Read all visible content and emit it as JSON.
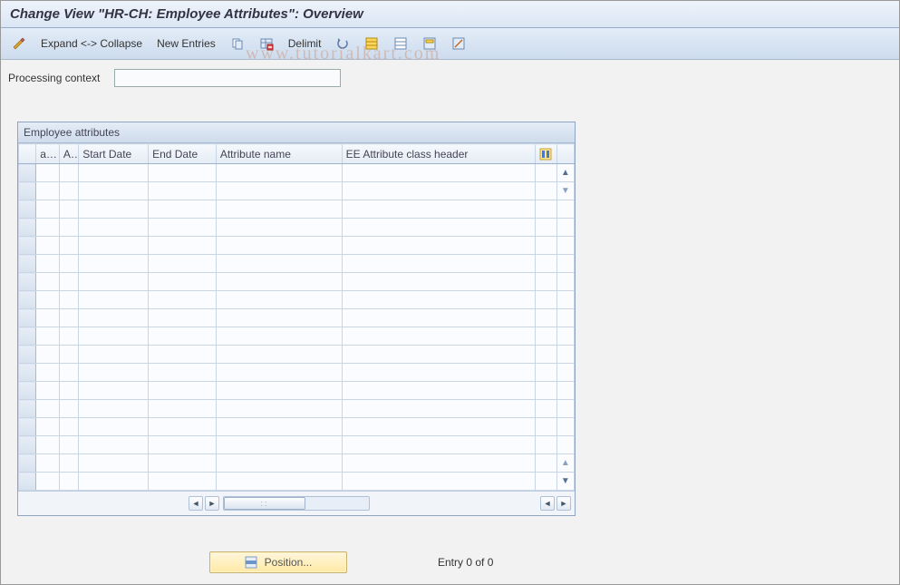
{
  "title": "Change View \"HR-CH: Employee Attributes\": Overview",
  "toolbar": {
    "expand_collapse": "Expand <-> Collapse",
    "new_entries": "New Entries",
    "delimit": "Delimit"
  },
  "context": {
    "label": "Processing context",
    "value": ""
  },
  "table": {
    "title": "Employee attributes",
    "columns": {
      "a1": "a...",
      "a2": "A..",
      "start": "Start Date",
      "end": "End Date",
      "attrname": "Attribute name",
      "classheader": "EE Attribute class header"
    },
    "row_count_empty": 18
  },
  "footer": {
    "position_btn": "Position...",
    "entry_text": "Entry 0 of 0"
  },
  "watermark": "www.tutorialkart.com"
}
